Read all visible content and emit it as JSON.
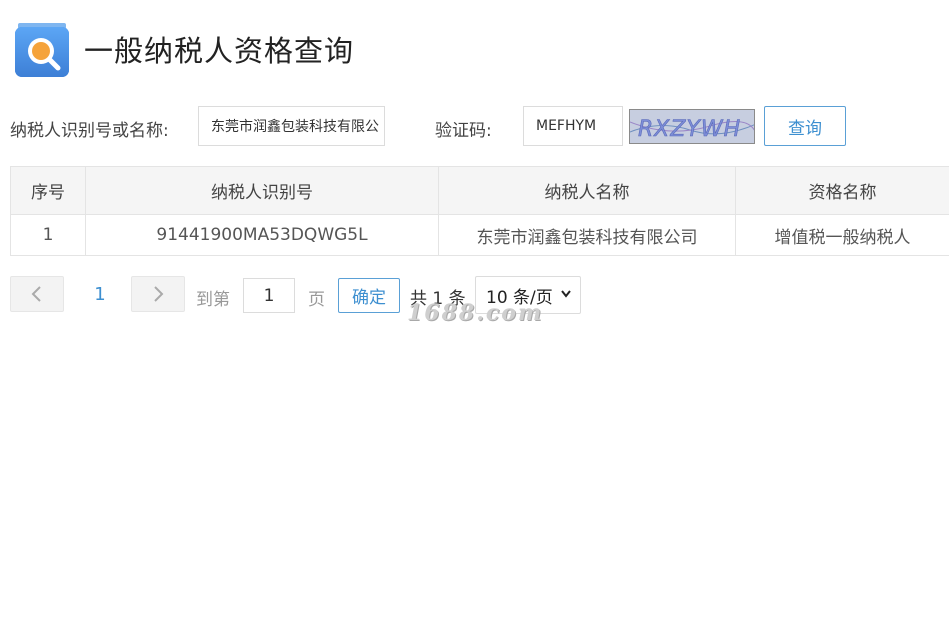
{
  "header": {
    "title": "一般纳税人资格查询",
    "icon": "search-magnifier-icon"
  },
  "search": {
    "taxpayer_label": "纳税人识别号或名称:",
    "taxpayer_value": "东莞市润鑫包装科技有限公",
    "captcha_label": "验证码:",
    "captcha_value": "MEFHYM",
    "captcha_image_text": "RXZYWH",
    "query_button": "查询"
  },
  "table": {
    "columns": [
      "序号",
      "纳税人识别号",
      "纳税人名称",
      "资格名称"
    ],
    "rows": [
      [
        "1",
        "91441900MA53DQWG5L",
        "东莞市润鑫包装科技有限公司",
        "增值税一般纳税人"
      ]
    ]
  },
  "pager": {
    "current_page": "1",
    "goto_label": "到第",
    "goto_value": "1",
    "page_unit": "页",
    "confirm_button": "确定",
    "total_text": "共 1 条",
    "page_size": "10 条/页"
  },
  "watermark": "1688.com",
  "colors": {
    "accent": "#3d8fd0",
    "header_bg": "#f5f5f5",
    "border": "#e4e4e4"
  }
}
